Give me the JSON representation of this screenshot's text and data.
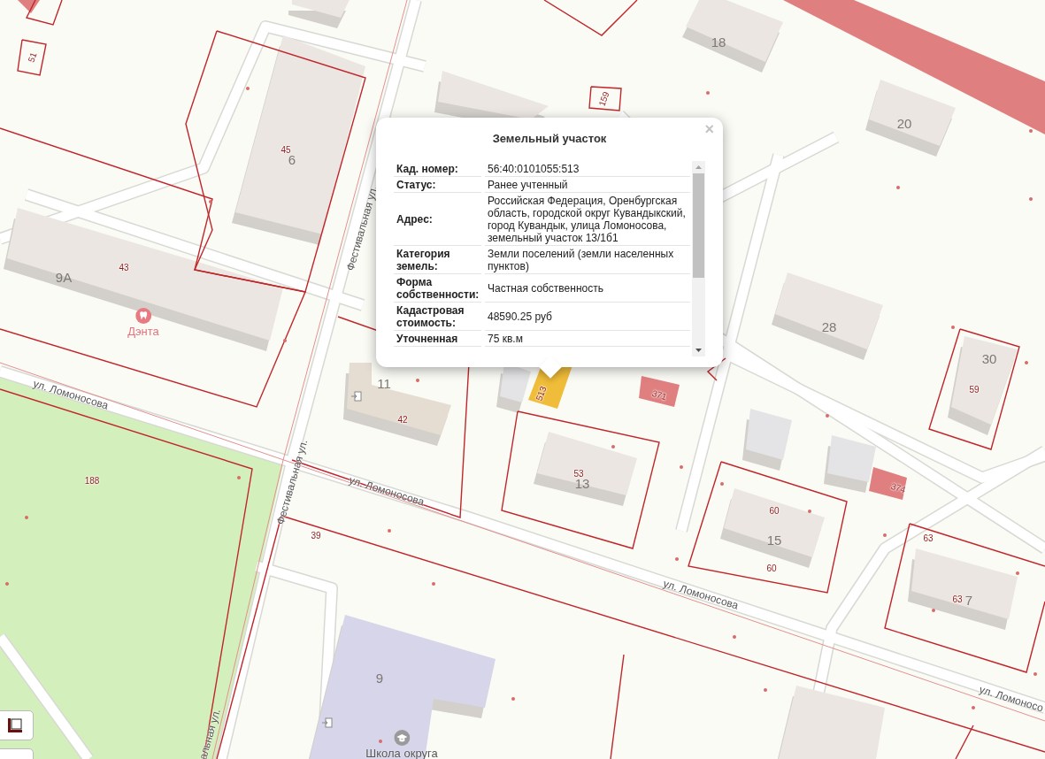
{
  "map": {
    "house_numbers": [
      "18",
      "20",
      "6",
      "9А",
      "11",
      "28",
      "30",
      "13",
      "15",
      "7",
      "9"
    ],
    "parcel_numbers": [
      "51",
      "159",
      "45",
      "43",
      "42",
      "53",
      "188",
      "39",
      "60",
      "60",
      "59",
      "63",
      "63",
      "371",
      "374",
      "513"
    ],
    "streets": [
      "ул. Ломоносова",
      "ул. Ломоносова",
      "ул. Ломоносова",
      "ул. Ломоносо",
      "Фестивальная ул.",
      "Фестивальная ул.",
      "альная ул."
    ],
    "places": [
      {
        "kind": "dentist",
        "name": "Дэнта"
      },
      {
        "kind": "school",
        "name": "Школа округа"
      }
    ]
  },
  "popup": {
    "title": "Земельный участок",
    "close": "×",
    "rows": [
      {
        "label": "Кад. номер:",
        "value": "56:40:0101055:513"
      },
      {
        "label": "Статус:",
        "value": "Ранее учтенный"
      },
      {
        "label": "Адрес:",
        "value": "Российская Федерация, Оренбургская область, городской округ Кувандыкский, город Кувандык, улица Ломоносова, земельный участок 13/1б1"
      },
      {
        "label": "Категория земель:",
        "value": "Земли поселений (земли населенных пунктов)"
      },
      {
        "label": "Форма собственности:",
        "value": "Частная собственность"
      },
      {
        "label": "Кадастровая стоимость:",
        "value": "48590.25 руб"
      },
      {
        "label": "Уточненная",
        "value": "75 кв.м"
      }
    ]
  }
}
